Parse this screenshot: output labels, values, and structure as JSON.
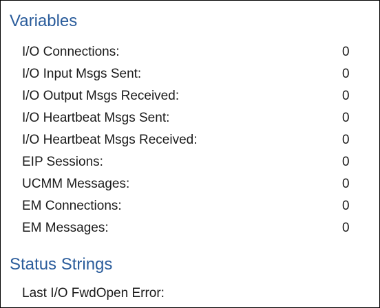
{
  "variables": {
    "title": "Variables",
    "rows": [
      {
        "label": "I/O Connections:",
        "value": "0"
      },
      {
        "label": "I/O Input Msgs Sent:",
        "value": "0"
      },
      {
        "label": "I/O Output Msgs Received:",
        "value": "0"
      },
      {
        "label": "I/O Heartbeat Msgs Sent:",
        "value": "0"
      },
      {
        "label": "I/O Heartbeat Msgs Received:",
        "value": "0"
      },
      {
        "label": "EIP Sessions:",
        "value": "0"
      },
      {
        "label": "UCMM Messages:",
        "value": "0"
      },
      {
        "label": "EM Connections:",
        "value": "0"
      },
      {
        "label": "EM Messages:",
        "value": "0"
      }
    ]
  },
  "status_strings": {
    "title": "Status Strings",
    "rows": [
      {
        "label": "Last I/O FwdOpen Error:",
        "value": ""
      }
    ]
  },
  "colors": {
    "section_title": "#2a5c9b",
    "text": "#1a1a1a",
    "border": "#000000"
  }
}
